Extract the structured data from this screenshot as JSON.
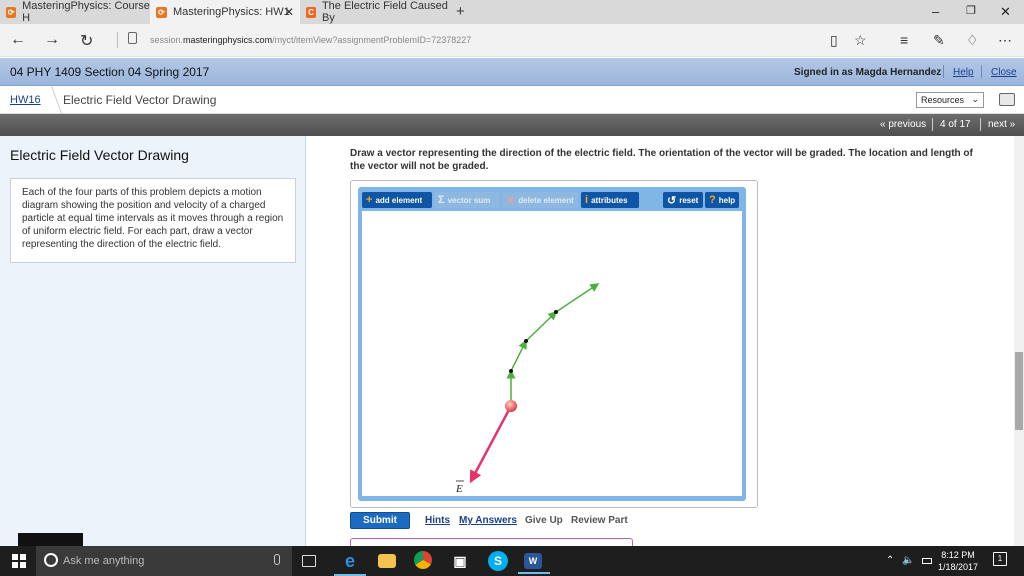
{
  "browser": {
    "tabs": [
      {
        "label": "MasteringPhysics: Course H",
        "active": false
      },
      {
        "label": "MasteringPhysics: HW1",
        "active": true
      },
      {
        "label": "The Electric Field Caused By",
        "active": false
      }
    ],
    "url_prefix": "session.",
    "url_domain": "masteringphysics.com",
    "url_path": "/myct/itemView?assignmentProblemID=72378227",
    "controls": {
      "minimize": "–",
      "restore": "❐",
      "close": "✕"
    }
  },
  "course": {
    "title": "04 PHY 1409 Section 04 Spring 2017",
    "signed_in": "Signed in as Magda Hernandez",
    "help": "Help",
    "close": "Close"
  },
  "breadcrumb": {
    "hw": "HW16",
    "title": "Electric Field Vector Drawing",
    "resources": "Resources"
  },
  "pager": {
    "previous": "« previous",
    "position": "4 of 17",
    "next": "next »"
  },
  "problem": {
    "title": "Electric Field Vector Drawing",
    "description": "Each of the four parts of this problem depicts a motion diagram showing the position and velocity of a charged particle at equal time intervals as it moves through a region of uniform electric field. For each part, draw a vector representing the direction of the electric field.",
    "instruction": "Draw a vector representing the direction of the electric field. The orientation of the vector will be graded. The location and length of the vector will not be graded."
  },
  "toolbar": {
    "add_element": "add element",
    "vector_sum": "vector sum",
    "delete_element": "delete element",
    "attributes": "attributes",
    "reset": "reset",
    "help": "help"
  },
  "canvas": {
    "vector_label": "E",
    "vector_color": "#e8336a",
    "path_color": "#4caf3f"
  },
  "actions": {
    "submit": "Submit",
    "hints": "Hints",
    "my_answers": "My Answers",
    "give_up": "Give Up",
    "review_part": "Review Part"
  },
  "taskbar": {
    "search_placeholder": "Ask me anything",
    "time": "8:12 PM",
    "date": "1/18/2017",
    "notification_count": "1"
  }
}
